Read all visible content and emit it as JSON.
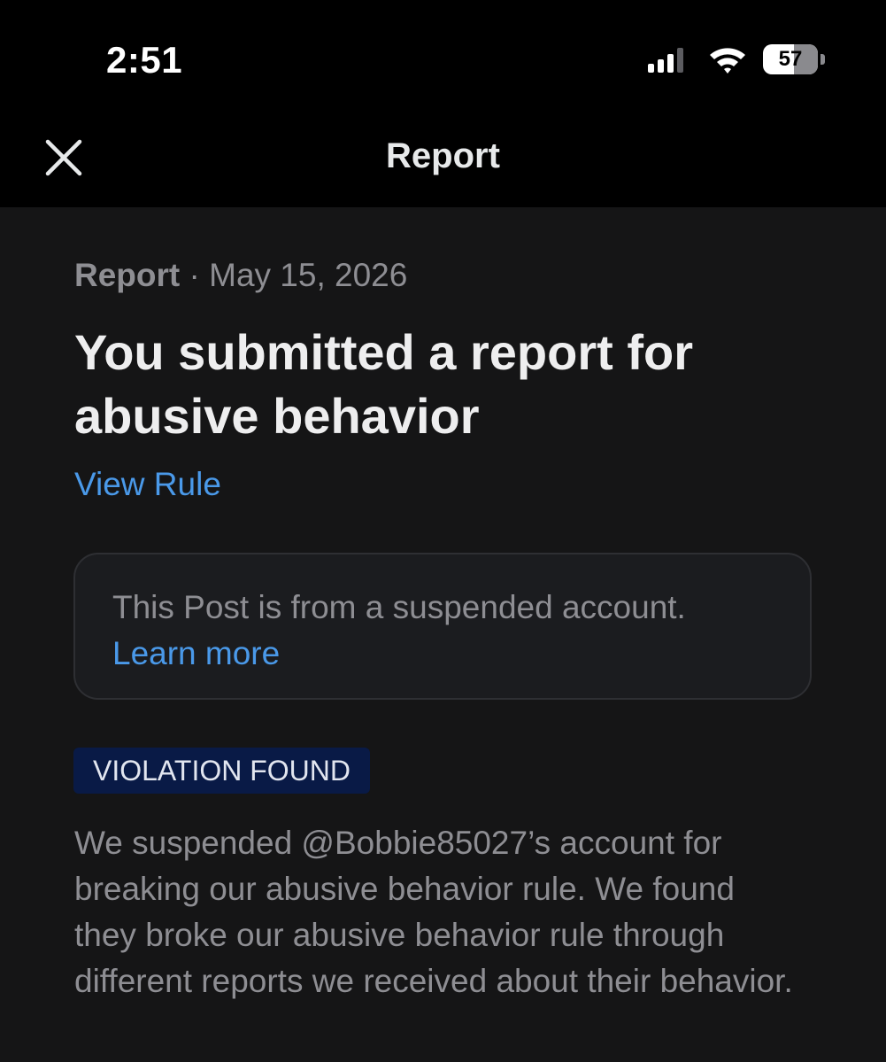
{
  "status_bar": {
    "time": "2:51",
    "battery_level": "57",
    "battery_fraction": 0.57
  },
  "header": {
    "title": "Report",
    "close_icon": "close-icon"
  },
  "report": {
    "meta_label": "Report",
    "meta_separator": " · ",
    "meta_date": "May 15, 2026",
    "headline": "You submitted a report for abusive behavior",
    "view_rule_link": "View Rule",
    "notice": {
      "text": "This Post is from a suspended account.",
      "link": "Learn more"
    },
    "badge": "VIOLATION FOUND",
    "result": "We suspended @Bobbie85027’s account for breaking our abusive behavior rule. We found they broke our abusive behavior rule through different reports we received about their behavior."
  },
  "colors": {
    "background": "#151516",
    "header_background": "#000000",
    "link": "#4a99e9",
    "muted_text": "#8e8e93",
    "badge_background": "#091a46"
  }
}
